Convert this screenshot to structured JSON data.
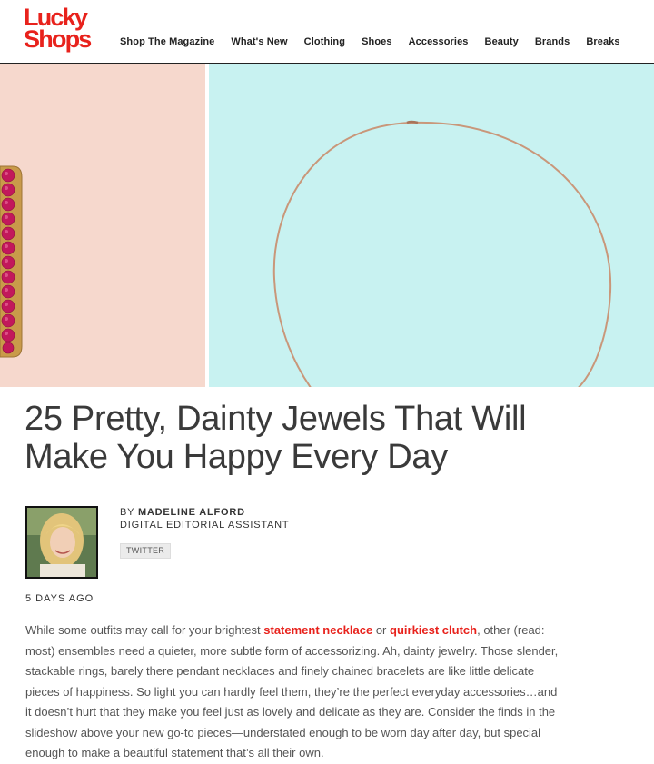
{
  "header": {
    "logo_line1": "Lucky",
    "logo_line2": "Shops",
    "nav": [
      {
        "label": "Shop The Magazine"
      },
      {
        "label": "What's New"
      },
      {
        "label": "Clothing"
      },
      {
        "label": "Shoes"
      },
      {
        "label": "Accessories"
      },
      {
        "label": "Beauty"
      },
      {
        "label": "Brands"
      },
      {
        "label": "Breaks"
      }
    ]
  },
  "colors": {
    "brand": "#e8221c",
    "hero_left_bg": "#f6d8cd",
    "hero_right_bg": "#c8f2f1",
    "hoop_gold": "#c9977a",
    "stone_pink": "#c2185b"
  },
  "hero": {
    "left_image": "ruby-bar-earring",
    "right_image": "gold-hoop-earring"
  },
  "article": {
    "title_line1": "25 Pretty, Dainty Jewels That Will",
    "title_line2": "Make You Happy Every Day",
    "author_prefix": "BY",
    "author_name": "MADELINE ALFORD",
    "author_role": "Digital Editorial Assistant",
    "twitter_label": "TWITTER",
    "date": "5 days ago",
    "body": {
      "p1": "While some outfits may call for your brightest ",
      "link1": "statement necklace",
      "p2": " or ",
      "link2": "quirkiest clutch",
      "p3": ", other (read: most) ensembles need a quieter, more subtle form of accessorizing. Ah, dainty jewelry. Those slender, stackable rings, barely there pendant necklaces and finely chained bracelets are like little delicate pieces of happiness. So light you can hardly feel them, they’re the perfect everyday accessories…and it doesn’t hurt that they make you feel just as lovely and delicate as they are. Consider the finds in the slideshow above your new go-to pieces—understated enough to be worn day after day, but special enough to make a beautiful statement that’s all their own."
    }
  }
}
